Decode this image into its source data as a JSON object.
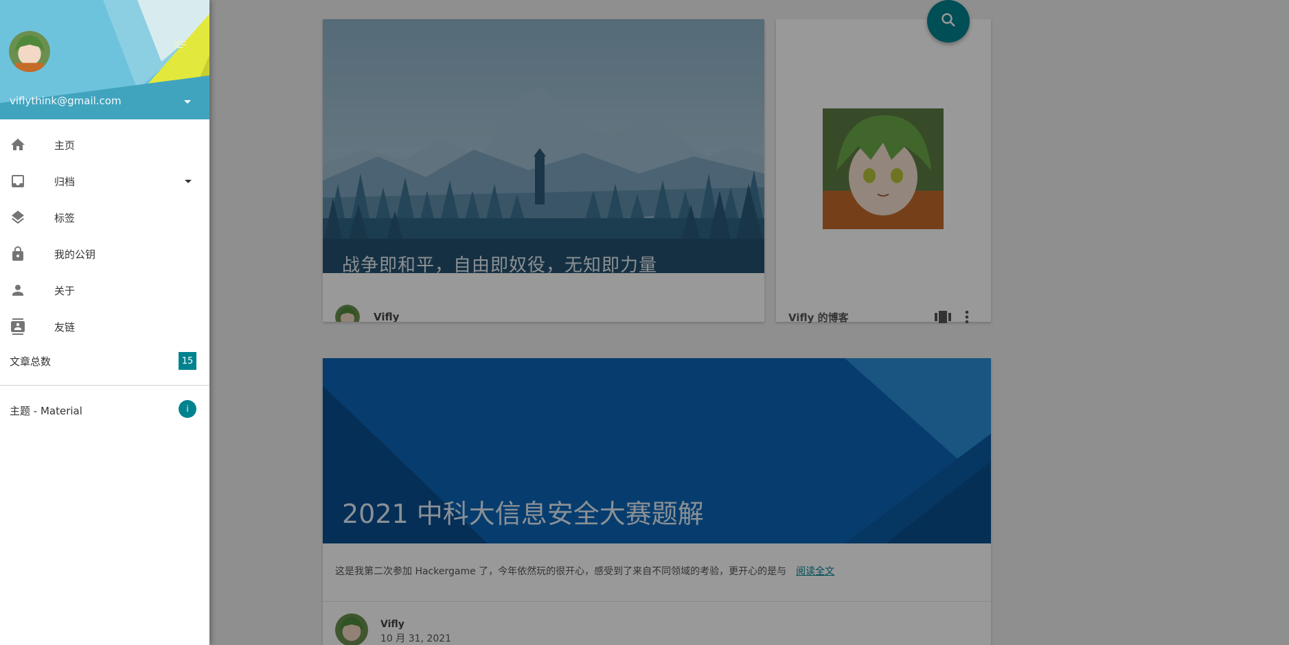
{
  "colors": {
    "accent": "#00838f",
    "header_blue": "#6ec3dc",
    "header_yellow": "#e3e83c",
    "page_bg": "#eeeeee",
    "post_blue": "#0a5ca6"
  },
  "drawer": {
    "email": "viflythink@gmail.com",
    "avatar_icon": "anime-avatar-icon",
    "nav": [
      {
        "label": "主页",
        "icon": "home-icon"
      },
      {
        "label": "归档",
        "icon": "inbox-icon",
        "has_dropdown": true
      },
      {
        "label": "标签",
        "icon": "layers-icon"
      },
      {
        "label": "我的公钥",
        "icon": "lock-icon"
      },
      {
        "label": "关于",
        "icon": "person-icon"
      },
      {
        "label": "友链",
        "icon": "contacts-icon"
      }
    ],
    "stat": {
      "label": "文章总数",
      "count": "15"
    },
    "theme": {
      "label": "主题 - Material",
      "badge": "i"
    }
  },
  "main": {
    "featured": {
      "title": "战争即和平，自由即奴役，无知即力量",
      "author": "Vifly"
    },
    "profile_card": {
      "blog_name": "Vifly 的博客",
      "icons": [
        "view-carousel-icon",
        "more-vert-icon"
      ]
    },
    "post": {
      "title": "2021 中科大信息安全大赛题解",
      "excerpt": "这是我第二次参加 Hackergame 了，今年依然玩的很开心，感受到了来自不同领域的考验，更开心的是与",
      "read_more": "阅读全文",
      "author": "Vifly",
      "date": "10 月 31, 2021"
    },
    "fab_icon": "search-icon"
  }
}
